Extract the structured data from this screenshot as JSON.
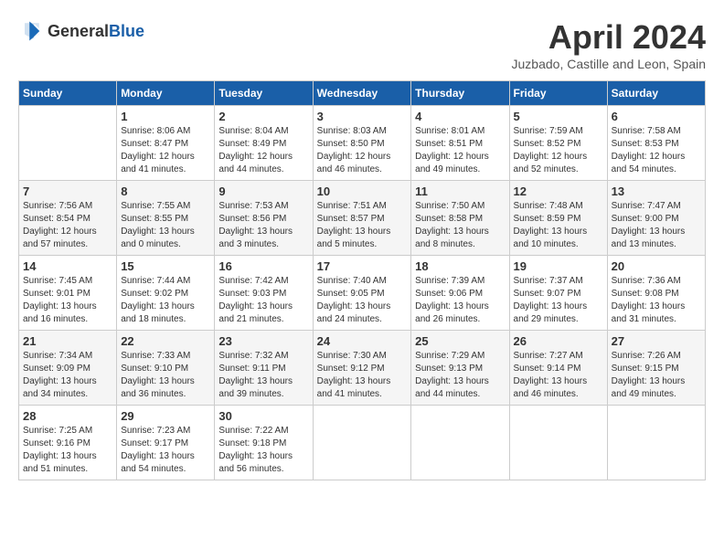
{
  "header": {
    "logo_general": "General",
    "logo_blue": "Blue",
    "title": "April 2024",
    "location": "Juzbado, Castille and Leon, Spain"
  },
  "days_of_week": [
    "Sunday",
    "Monday",
    "Tuesday",
    "Wednesday",
    "Thursday",
    "Friday",
    "Saturday"
  ],
  "weeks": [
    [
      {
        "day": "",
        "info": ""
      },
      {
        "day": "1",
        "info": "Sunrise: 8:06 AM\nSunset: 8:47 PM\nDaylight: 12 hours\nand 41 minutes."
      },
      {
        "day": "2",
        "info": "Sunrise: 8:04 AM\nSunset: 8:49 PM\nDaylight: 12 hours\nand 44 minutes."
      },
      {
        "day": "3",
        "info": "Sunrise: 8:03 AM\nSunset: 8:50 PM\nDaylight: 12 hours\nand 46 minutes."
      },
      {
        "day": "4",
        "info": "Sunrise: 8:01 AM\nSunset: 8:51 PM\nDaylight: 12 hours\nand 49 minutes."
      },
      {
        "day": "5",
        "info": "Sunrise: 7:59 AM\nSunset: 8:52 PM\nDaylight: 12 hours\nand 52 minutes."
      },
      {
        "day": "6",
        "info": "Sunrise: 7:58 AM\nSunset: 8:53 PM\nDaylight: 12 hours\nand 54 minutes."
      }
    ],
    [
      {
        "day": "7",
        "info": "Sunrise: 7:56 AM\nSunset: 8:54 PM\nDaylight: 12 hours\nand 57 minutes."
      },
      {
        "day": "8",
        "info": "Sunrise: 7:55 AM\nSunset: 8:55 PM\nDaylight: 13 hours\nand 0 minutes."
      },
      {
        "day": "9",
        "info": "Sunrise: 7:53 AM\nSunset: 8:56 PM\nDaylight: 13 hours\nand 3 minutes."
      },
      {
        "day": "10",
        "info": "Sunrise: 7:51 AM\nSunset: 8:57 PM\nDaylight: 13 hours\nand 5 minutes."
      },
      {
        "day": "11",
        "info": "Sunrise: 7:50 AM\nSunset: 8:58 PM\nDaylight: 13 hours\nand 8 minutes."
      },
      {
        "day": "12",
        "info": "Sunrise: 7:48 AM\nSunset: 8:59 PM\nDaylight: 13 hours\nand 10 minutes."
      },
      {
        "day": "13",
        "info": "Sunrise: 7:47 AM\nSunset: 9:00 PM\nDaylight: 13 hours\nand 13 minutes."
      }
    ],
    [
      {
        "day": "14",
        "info": "Sunrise: 7:45 AM\nSunset: 9:01 PM\nDaylight: 13 hours\nand 16 minutes."
      },
      {
        "day": "15",
        "info": "Sunrise: 7:44 AM\nSunset: 9:02 PM\nDaylight: 13 hours\nand 18 minutes."
      },
      {
        "day": "16",
        "info": "Sunrise: 7:42 AM\nSunset: 9:03 PM\nDaylight: 13 hours\nand 21 minutes."
      },
      {
        "day": "17",
        "info": "Sunrise: 7:40 AM\nSunset: 9:05 PM\nDaylight: 13 hours\nand 24 minutes."
      },
      {
        "day": "18",
        "info": "Sunrise: 7:39 AM\nSunset: 9:06 PM\nDaylight: 13 hours\nand 26 minutes."
      },
      {
        "day": "19",
        "info": "Sunrise: 7:37 AM\nSunset: 9:07 PM\nDaylight: 13 hours\nand 29 minutes."
      },
      {
        "day": "20",
        "info": "Sunrise: 7:36 AM\nSunset: 9:08 PM\nDaylight: 13 hours\nand 31 minutes."
      }
    ],
    [
      {
        "day": "21",
        "info": "Sunrise: 7:34 AM\nSunset: 9:09 PM\nDaylight: 13 hours\nand 34 minutes."
      },
      {
        "day": "22",
        "info": "Sunrise: 7:33 AM\nSunset: 9:10 PM\nDaylight: 13 hours\nand 36 minutes."
      },
      {
        "day": "23",
        "info": "Sunrise: 7:32 AM\nSunset: 9:11 PM\nDaylight: 13 hours\nand 39 minutes."
      },
      {
        "day": "24",
        "info": "Sunrise: 7:30 AM\nSunset: 9:12 PM\nDaylight: 13 hours\nand 41 minutes."
      },
      {
        "day": "25",
        "info": "Sunrise: 7:29 AM\nSunset: 9:13 PM\nDaylight: 13 hours\nand 44 minutes."
      },
      {
        "day": "26",
        "info": "Sunrise: 7:27 AM\nSunset: 9:14 PM\nDaylight: 13 hours\nand 46 minutes."
      },
      {
        "day": "27",
        "info": "Sunrise: 7:26 AM\nSunset: 9:15 PM\nDaylight: 13 hours\nand 49 minutes."
      }
    ],
    [
      {
        "day": "28",
        "info": "Sunrise: 7:25 AM\nSunset: 9:16 PM\nDaylight: 13 hours\nand 51 minutes."
      },
      {
        "day": "29",
        "info": "Sunrise: 7:23 AM\nSunset: 9:17 PM\nDaylight: 13 hours\nand 54 minutes."
      },
      {
        "day": "30",
        "info": "Sunrise: 7:22 AM\nSunset: 9:18 PM\nDaylight: 13 hours\nand 56 minutes."
      },
      {
        "day": "",
        "info": ""
      },
      {
        "day": "",
        "info": ""
      },
      {
        "day": "",
        "info": ""
      },
      {
        "day": "",
        "info": ""
      }
    ]
  ]
}
